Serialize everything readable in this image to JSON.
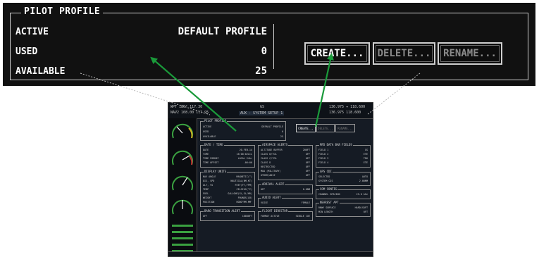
{
  "profile": {
    "title": "PILOT PROFILE",
    "active_label": "ACTIVE",
    "active_value": "DEFAULT PROFILE",
    "used_label": "USED",
    "used_value": "0",
    "available_label": "AVAILABLE",
    "available_value": "25",
    "buttons": {
      "create": "CREATE...",
      "delete": "DELETE...",
      "rename": "RENAME..."
    }
  },
  "mfd": {
    "top_left_1": "WPT 180° 117.30",
    "top_left_2": "NAV2 108.00 117.95",
    "top_mid_1": "GS",
    "top_mid_2": "AUX - SYSTEM SETUP 1",
    "top_right_1": "136.975 ↔ 118.600",
    "top_right_2": "136.975 118.600",
    "pilot_profile": {
      "title": "PILOT PROFILE",
      "active": "ACTIVE",
      "active_val": "DEFAULT PROFILE",
      "used": "USED",
      "used_val": "0",
      "available": "AVAILABLE",
      "available_val": "25",
      "create": "CREATE...",
      "delete": "DELETE...",
      "rename": "RENAME..."
    },
    "date_time": {
      "title": "DATE / TIME",
      "rows": [
        {
          "l": "DATE",
          "v": "20-FEB-14"
        },
        {
          "l": "TIME",
          "v": "16:00:02LCL"
        },
        {
          "l": "TIME FORMAT",
          "v": "LOCAL 24hr"
        },
        {
          "l": "TIME OFFSET",
          "v": "-06:00"
        }
      ]
    },
    "display_units": {
      "title": "DISPLAY UNITS",
      "rows": [
        {
          "l": "NAV ANGLE",
          "v": "MAGNETIC(°)"
        },
        {
          "l": "DIS, SPD",
          "v": "NAUTICAL(NM,KT)"
        },
        {
          "l": "ALT, VS",
          "v": "FEET(FT,FPM)"
        },
        {
          "l": "TEMP",
          "v": "CELSIUS(°C)"
        },
        {
          "l": "FUEL",
          "v": "GALLONS(GL,GL/HR)"
        },
        {
          "l": "WEIGHT",
          "v": "POUNDS(LB)"
        },
        {
          "l": "POSITION",
          "v": "HDDD°MM.MM'"
        }
      ]
    },
    "baro_transition": {
      "title": "BARO TRANSITION ALERT",
      "l": "OFF",
      "v": "18000FT"
    },
    "airspace_alerts": {
      "title": "AIRSPACE ALERTS",
      "rows": [
        {
          "l": "ALTITUDE BUFFER",
          "v": "200FT"
        },
        {
          "l": "CLASS B/TCA",
          "v": "OFF"
        },
        {
          "l": "CLASS C/TCA",
          "v": "OFF"
        },
        {
          "l": "CLASS D",
          "v": "OFF"
        },
        {
          "l": "RESTRICTED",
          "v": "OFF"
        },
        {
          "l": "MOA (MILITARY)",
          "v": "OFF"
        },
        {
          "l": "OTHER/ADIZ",
          "v": "OFF"
        }
      ]
    },
    "arrival_alert": {
      "title": "ARRIVAL ALERT",
      "l": "OFF",
      "v": "0.0NM"
    },
    "audio_alert": {
      "title": "AUDIO ALERT",
      "l": "VOICE",
      "v": "FEMALE"
    },
    "flight_director": {
      "title": "FLIGHT DIRECTOR",
      "l": "FORMAT ACTIVE",
      "v": "SINGLE CUE"
    },
    "mfd_data_bar": {
      "title": "MFD DATA BAR FIELDS",
      "rows": [
        {
          "l": "FIELD 1",
          "v": "GS"
        },
        {
          "l": "FIELD 2",
          "v": "ETE"
        },
        {
          "l": "FIELD 3",
          "v": "TRK"
        },
        {
          "l": "FIELD 4",
          "v": "ETE"
        }
      ]
    },
    "gps_cdi": {
      "title": "GPS CDI",
      "rows": [
        {
          "l": "SELECTED",
          "v": "AUTO"
        },
        {
          "l": "SYSTEM CDI",
          "v": "2.00NM"
        }
      ]
    },
    "com_config": {
      "title": "COM CONFIG",
      "l": "CHANNEL SPACING",
      "v": "25.0 kHz"
    },
    "nearest_apt": {
      "title": "NEAREST APT",
      "rows": [
        {
          "l": "RNWY SURFACE",
          "v": "HARD/SOFT"
        },
        {
          "l": "MIN LENGTH",
          "v": "0FT"
        }
      ]
    }
  }
}
